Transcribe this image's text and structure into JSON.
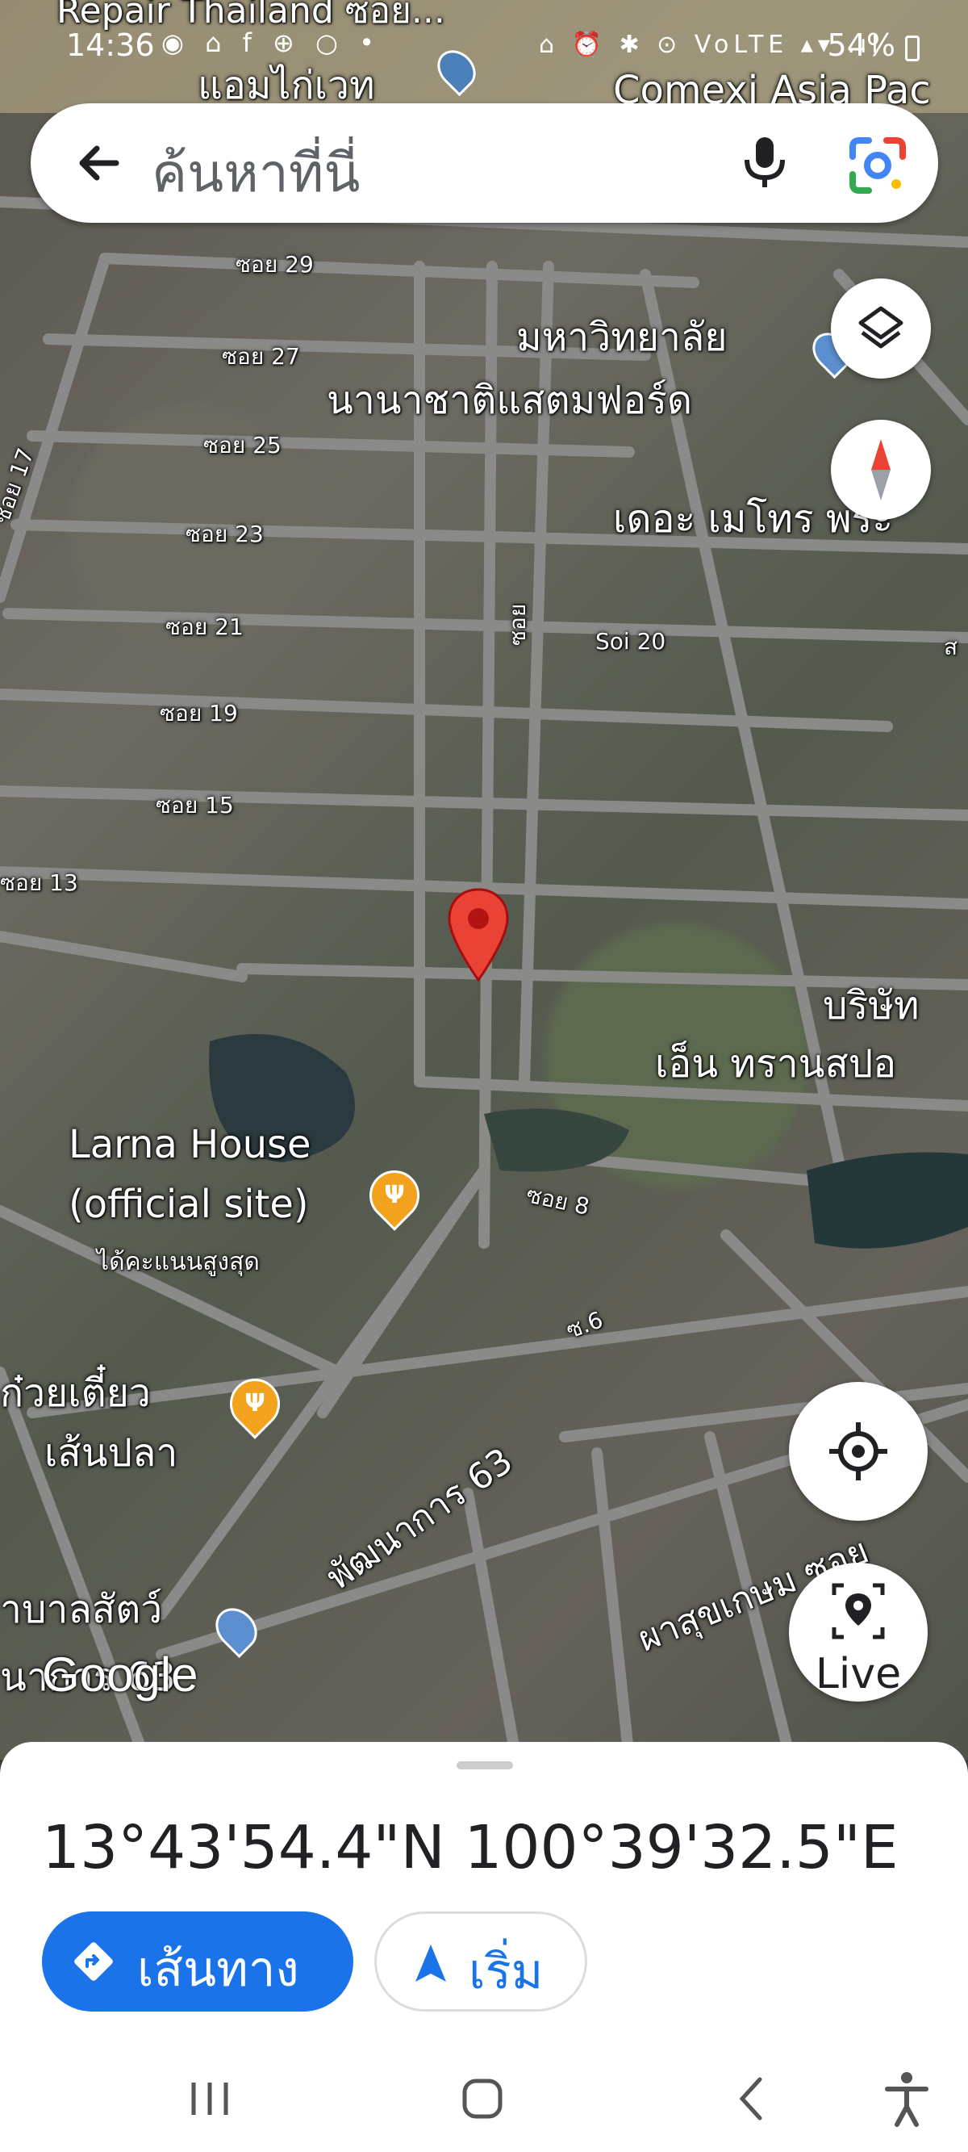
{
  "status_bar": {
    "time": "14:36",
    "battery": "54%",
    "left_icons": "◉ ⌂ f ⊕ ○ •",
    "right_icons": "⌂ ⏰ ✱ ⊙ VoLTE ▴▾ .ıl"
  },
  "search": {
    "placeholder": "ค้นหาที่นี่",
    "back_icon": "arrow-left-icon",
    "mic_icon": "mic-icon",
    "lens_icon": "google-lens-icon"
  },
  "map": {
    "labels": {
      "top_street": "Repair Thailand ซอย...",
      "place_amkowet": "แอมไก่เวท",
      "place_comexi": "Comexi Asia Pac",
      "university_line1": "มหาวิทยาลัย",
      "university_line2": "นานาชาติแสตมฟอร์ด",
      "metro": "เดอะ เมโทร พระ",
      "soi29": "ซอย 29",
      "soi27": "ซอย 27",
      "soi25": "ซอย 25",
      "soi23": "ซอย 23",
      "soi21": "ซอย 21",
      "soi19": "ซอย 19",
      "soi15": "ซอย 15",
      "soi13": "ซอย 13",
      "soi17": "ซอย 17",
      "soi20": "Soi 20",
      "soi_vertical": "ซอย",
      "soi8": "ซอย 8",
      "so6": "ซ.6",
      "company_line1": "บริษัท",
      "company_line2": "เอ็น ทรานสปอ",
      "larna_line1": "Larna House",
      "larna_line2": "(official site)",
      "larna_rating": "ได้คะแนนสูงสุด",
      "noodle_line1": "ก๋วยเตี๋ยว",
      "noodle_line2": "เส้นปลา",
      "road_pattanakan": "พัฒนาการ 63",
      "road_phasuk": "ผาสุขเกษม ซอย",
      "vet_line1": "าบาลสัตว์",
      "vet_line2": "นาการ 63",
      "edge_partial": "ส"
    },
    "google_wordmark": "Google",
    "pin_color": "#ea4335",
    "food_pin_color": "#f3a21d"
  },
  "controls": {
    "layers_icon": "layers-icon",
    "compass_icon": "compass-icon",
    "location_icon": "my-location-icon",
    "live_icon": "live-view-icon",
    "live_label": "Live"
  },
  "sheet": {
    "coordinates": "13°43'54.4\"N 100°39'32.5\"E",
    "directions_label": "เส้นทาง",
    "start_label": "เริ่ม",
    "accent": "#1a73e8"
  },
  "nav": {
    "recents_icon": "recents-icon",
    "home_icon": "home-icon",
    "back_icon": "back-icon",
    "accessibility_icon": "accessibility-icon"
  }
}
